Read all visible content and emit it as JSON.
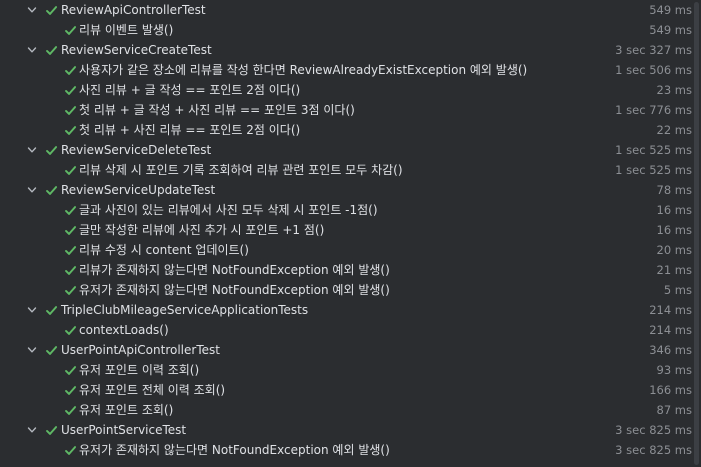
{
  "colors": {
    "background": "#2b2d30",
    "text": "#dfe1e5",
    "time": "#8c8f94",
    "pass": "#5fb865"
  },
  "icons": {
    "expand": "chevron-down-icon",
    "status": "check-icon"
  },
  "rows": [
    {
      "type": "suite",
      "label": "ReviewApiControllerTest",
      "time": "549 ms"
    },
    {
      "type": "test",
      "label": "리뷰 이벤트 발생()",
      "time": "549 ms"
    },
    {
      "type": "suite",
      "label": "ReviewServiceCreateTest",
      "time": "3 sec 327 ms"
    },
    {
      "type": "test",
      "label": "사용자가 같은 장소에 리뷰를 작성 한다면 ReviewAlreadyExistException 예외 발생()",
      "time": "1 sec 506 ms"
    },
    {
      "type": "test",
      "label": "사진 리뷰 + 글 작성 == 포인트 2점 이다()",
      "time": "23 ms"
    },
    {
      "type": "test",
      "label": "첫 리뷰 + 글 작성 + 사진 리뷰 == 포인트 3점 이다()",
      "time": "1 sec 776 ms"
    },
    {
      "type": "test",
      "label": "첫 리뷰 + 사진 리뷰 == 포인트 2점 이다()",
      "time": "22 ms"
    },
    {
      "type": "suite",
      "label": "ReviewServiceDeleteTest",
      "time": "1 sec 525 ms"
    },
    {
      "type": "test",
      "label": "리뷰 삭제 시 포인트 기록 조회하여 리뷰 관련 포인트 모두 차감()",
      "time": "1 sec 525 ms"
    },
    {
      "type": "suite",
      "label": "ReviewServiceUpdateTest",
      "time": "78 ms"
    },
    {
      "type": "test",
      "label": "글과 사진이 있는 리뷰에서 사진 모두 삭제 시 포인트 -1점()",
      "time": "16 ms"
    },
    {
      "type": "test",
      "label": "글만 작성한 리뷰에 사진 추가 시 포인트 +1 점()",
      "time": "16 ms"
    },
    {
      "type": "test",
      "label": "리뷰 수정 시 content 업데이트()",
      "time": "20 ms"
    },
    {
      "type": "test",
      "label": "리뷰가 존재하지 않는다면 NotFoundException 예외 발생()",
      "time": "21 ms"
    },
    {
      "type": "test",
      "label": "유저가 존재하지 않는다면 NotFoundException 예외 발생()",
      "time": "5 ms"
    },
    {
      "type": "suite",
      "label": "TripleClubMileageServiceApplicationTests",
      "time": "214 ms"
    },
    {
      "type": "test",
      "label": "contextLoads()",
      "time": "214 ms"
    },
    {
      "type": "suite",
      "label": "UserPointApiControllerTest",
      "time": "346 ms"
    },
    {
      "type": "test",
      "label": "유저 포인트 이력 조회()",
      "time": "93 ms"
    },
    {
      "type": "test",
      "label": "유저 포인트 전체 이력 조회()",
      "time": "166 ms"
    },
    {
      "type": "test",
      "label": "유저 포인트 조회()",
      "time": "87 ms"
    },
    {
      "type": "suite",
      "label": "UserPointServiceTest",
      "time": "3 sec 825 ms"
    },
    {
      "type": "test",
      "label": "유저가 존재하지 않는다면 NotFoundException 예외 발생()",
      "time": "3 sec 825 ms"
    }
  ]
}
